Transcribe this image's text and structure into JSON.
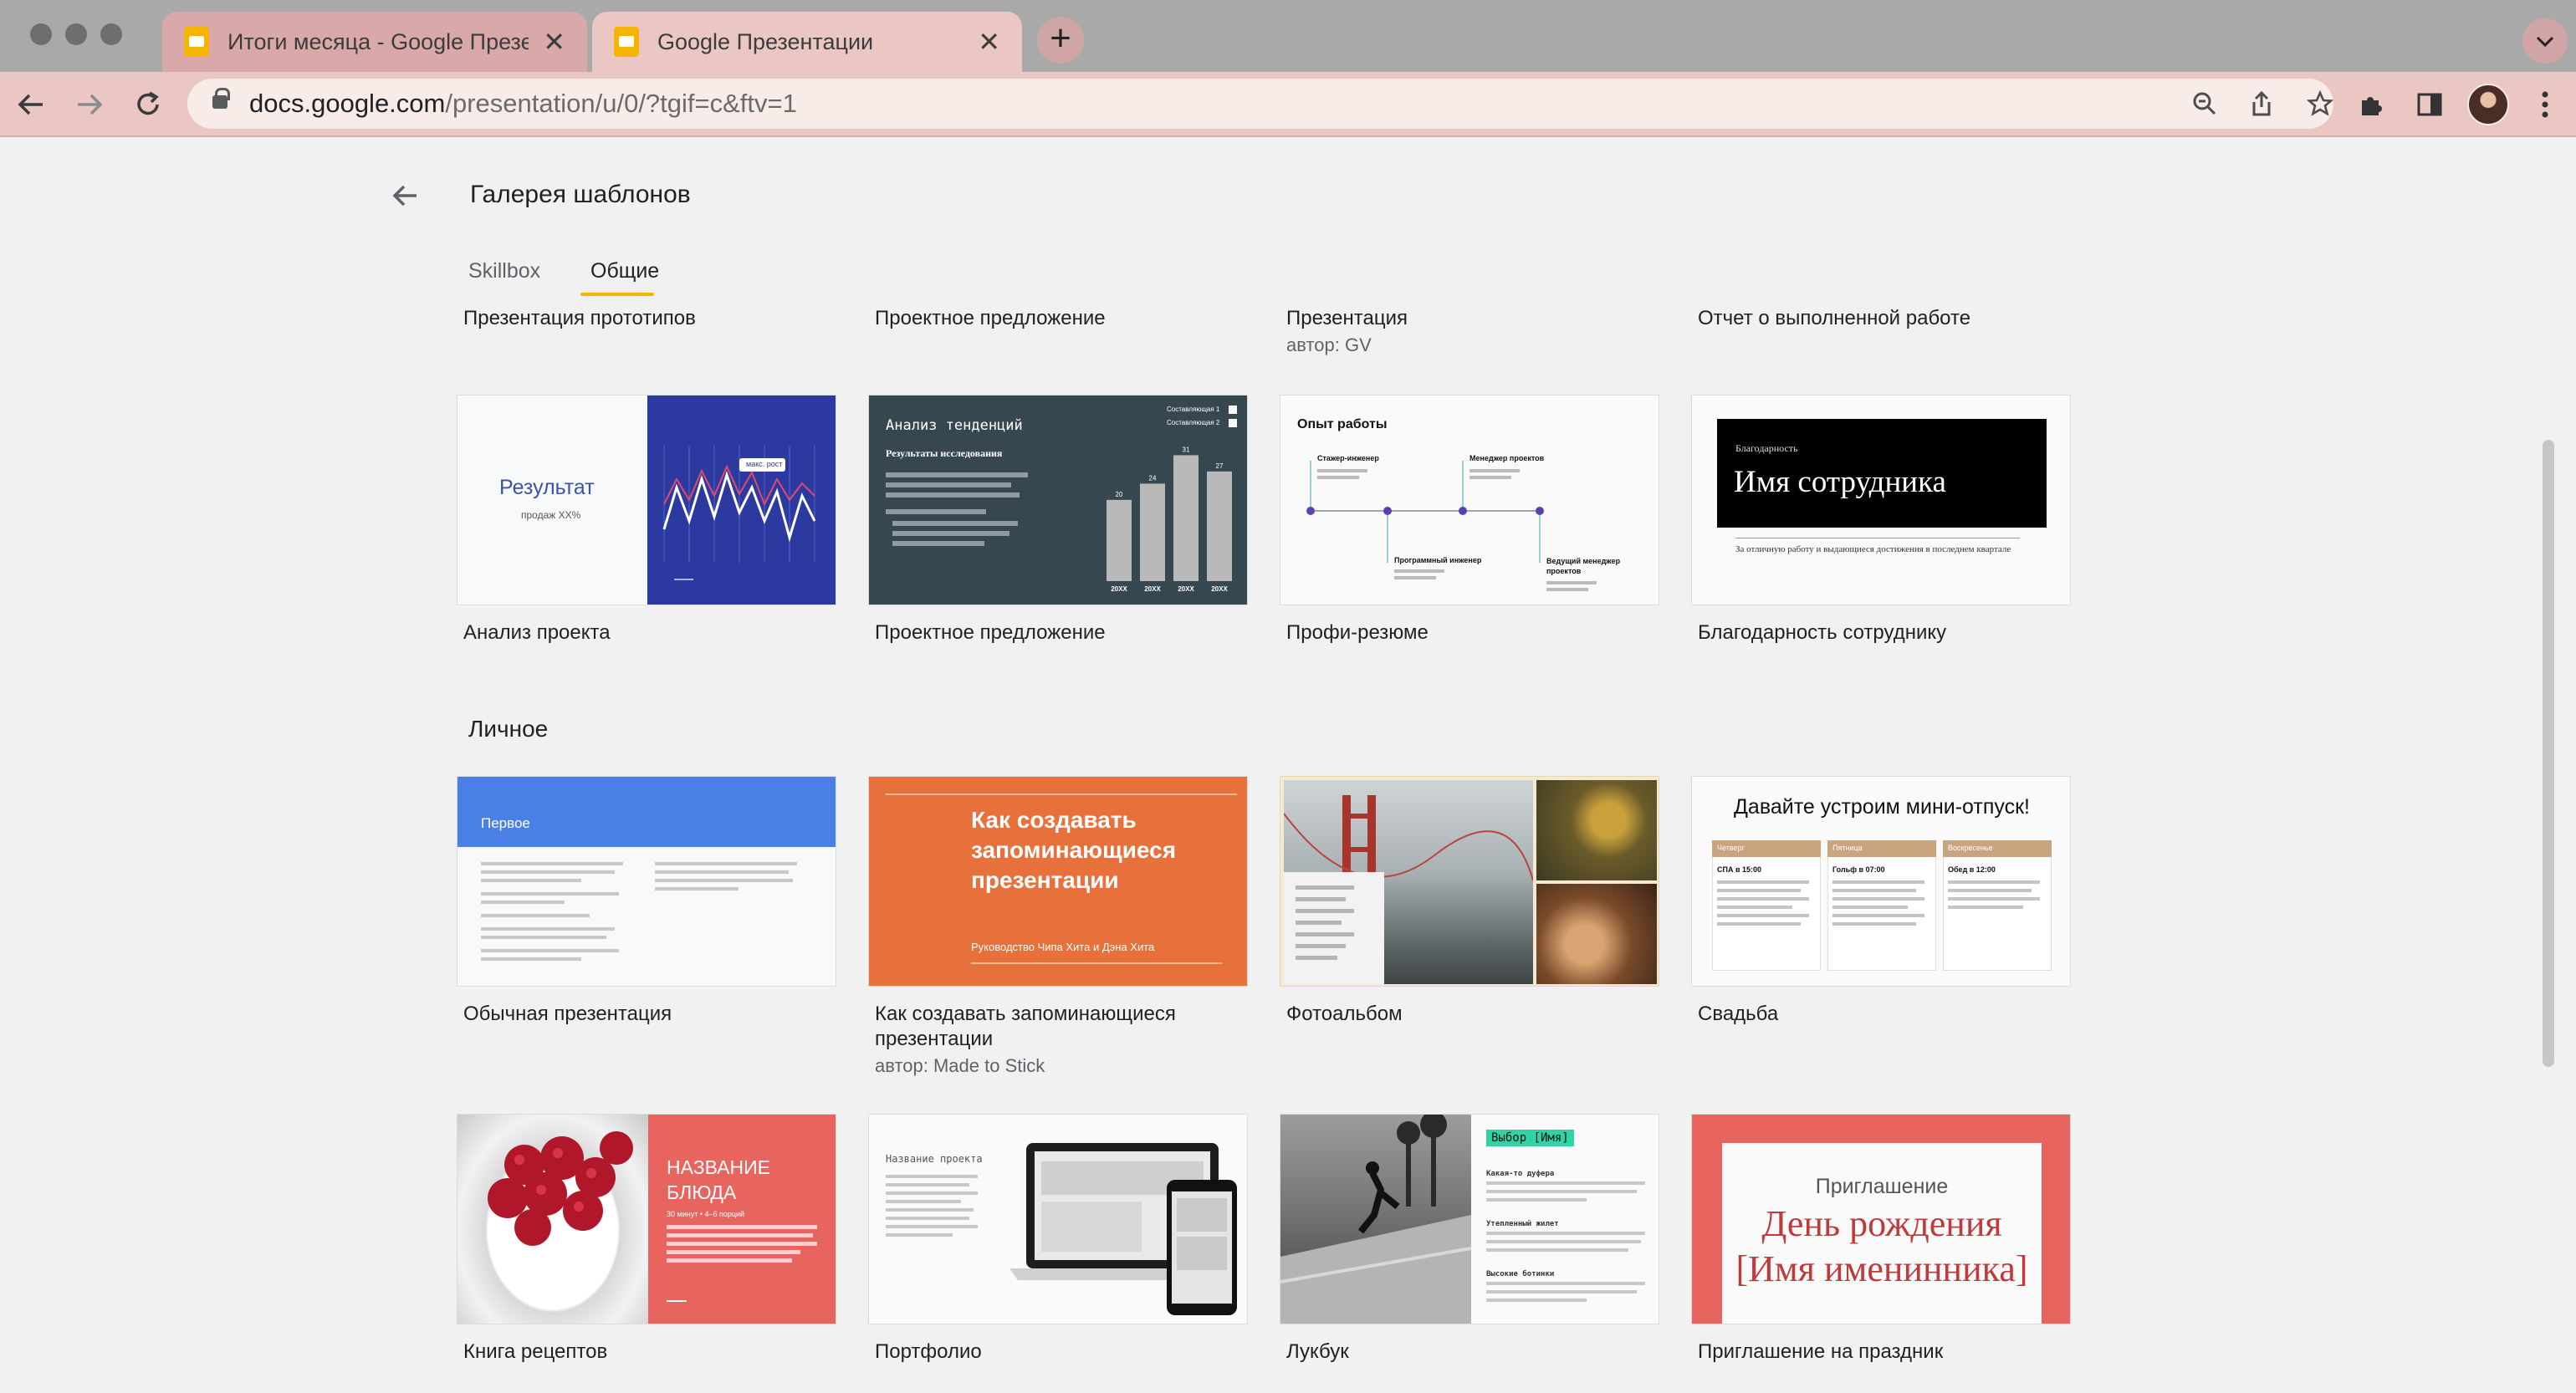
{
  "browser": {
    "tabs": [
      {
        "title": "Итоги месяца - Google Презе",
        "close": "✕"
      },
      {
        "title": "Google Презентации",
        "close": "✕"
      }
    ],
    "new_tab": "+",
    "url_host": "docs.google.com",
    "url_path": "/presentation/u/0/?tgif=c&ftv=1"
  },
  "gallery": {
    "title": "Галерея шаблонов",
    "tabs": [
      "Skillbox",
      "Общие"
    ],
    "top_labels": [
      {
        "title": "Презентация прототипов",
        "author": ""
      },
      {
        "title": "Проектное предложение",
        "author": ""
      },
      {
        "title": "Презентация",
        "author": "автор: GV"
      },
      {
        "title": "Отчет о выполненной работе",
        "author": ""
      }
    ],
    "work_templates": [
      {
        "title": "Анализ проекта"
      },
      {
        "title": "Проектное предложение"
      },
      {
        "title": "Профи-резюме"
      },
      {
        "title": "Благодарность сотруднику"
      }
    ],
    "personal_section": "Личное",
    "personal_templates": [
      {
        "title": "Обычная презентация",
        "title2": "",
        "author": ""
      },
      {
        "title": "Как создавать запоминающиеся",
        "title2": "презентации",
        "author": "автор: Made to Stick"
      },
      {
        "title": "Фотоальбом",
        "title2": "",
        "author": ""
      },
      {
        "title": "Свадьба",
        "title2": "",
        "author": ""
      }
    ],
    "more_templates": [
      {
        "title": "Книга рецептов"
      },
      {
        "title": "Портфолио"
      },
      {
        "title": "Лукбук"
      },
      {
        "title": "Приглашение на праздник"
      }
    ]
  },
  "thumbs": {
    "analysis": {
      "result": "Результат",
      "sub": "продаж XX%",
      "tooltip": "макс. рост"
    },
    "proposal": {
      "title": "Анализ тенденций",
      "subtitle": "Результаты исследования",
      "legend1": "Составляющая 1",
      "legend2": "Составляющая 2",
      "bars": [
        20,
        24,
        31,
        27
      ],
      "bar_label": "20XX"
    },
    "resume": {
      "title": "Опыт работы",
      "role1": "Стажер-инженер",
      "role2": "Менеджер проектов",
      "role3": "Программный инженер",
      "role4": "Ведущий менеджер проектов"
    },
    "thanks": {
      "small": "Благодарность",
      "name": "Имя сотрудника",
      "text": "За отличную работу и выдающиеся достижения в последнем квартале"
    },
    "plain": {
      "title": "Первое"
    },
    "memorable": {
      "title": "Как создавать запоминающиеся презентации",
      "sub": "Руководство Чипа Хита и Дэна Хита"
    },
    "wedding": {
      "title": "Давайте устроим мини-отпуск!",
      "col1": "Четверг",
      "col2": "Пятница",
      "col3": "Воскресенье",
      "t1": "СПА в 15:00",
      "t2": "Гольф в 07:00",
      "t3": "Обед в 12:00"
    },
    "recipe": {
      "title": "НАЗВАНИЕ БЛЮДА",
      "sub": "30 минут • 4–6 порций"
    },
    "portfolio": {
      "title": "Название проекта"
    },
    "lookbook": {
      "tag": "Выбор [Имя]",
      "h1": "Какая-то дуфера",
      "h2": "Утепленный жилет",
      "h3": "Высокие ботинки"
    },
    "invite": {
      "small": "Приглашение",
      "big": "День рождения [Имя именинника]"
    }
  }
}
